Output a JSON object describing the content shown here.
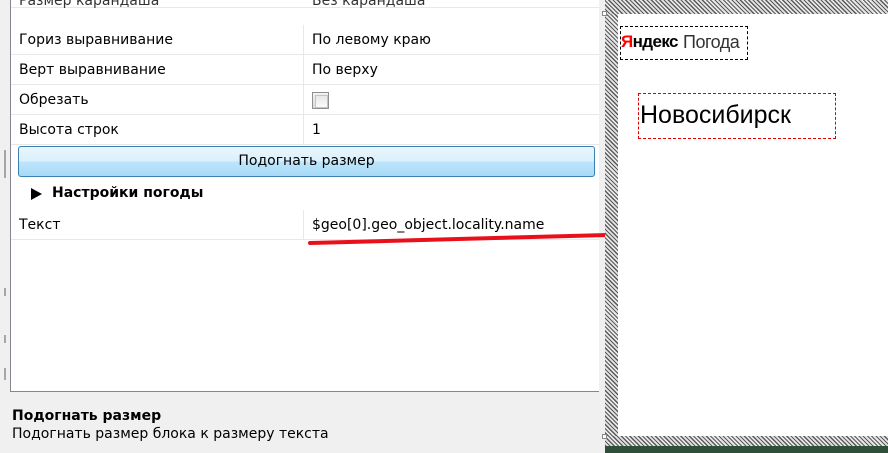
{
  "property_grid": {
    "clipped_row": {
      "key": "Размер карандаша",
      "value": "Без карандаша"
    },
    "rows": [
      {
        "key": "Гориз выравнивание",
        "value": "По левому краю"
      },
      {
        "key": "Верт выравнивание",
        "value": "По верху"
      },
      {
        "key": "Обрезать",
        "checked": false
      },
      {
        "key": "Высота строк",
        "value": "1"
      }
    ],
    "fit_button": "Подогнать размер",
    "section": {
      "label": "Настройки погоды",
      "icon": "expand-triangle-icon",
      "expanded": false
    },
    "text_row": {
      "key": "Текст",
      "value": "$geo[0].geo_object.locality.name"
    },
    "highlight_color": "#e8101a"
  },
  "description": {
    "title": "Подогнать размер",
    "text": "Подогнать размер блока к размеру текста"
  },
  "preview": {
    "logo_yandex_first": "Я",
    "logo_yandex_rest": "ндекс",
    "logo_weather": "Погода",
    "city": "Новосибирск",
    "accent_green": "#2f4f3a",
    "selection_color": "#e00000"
  }
}
